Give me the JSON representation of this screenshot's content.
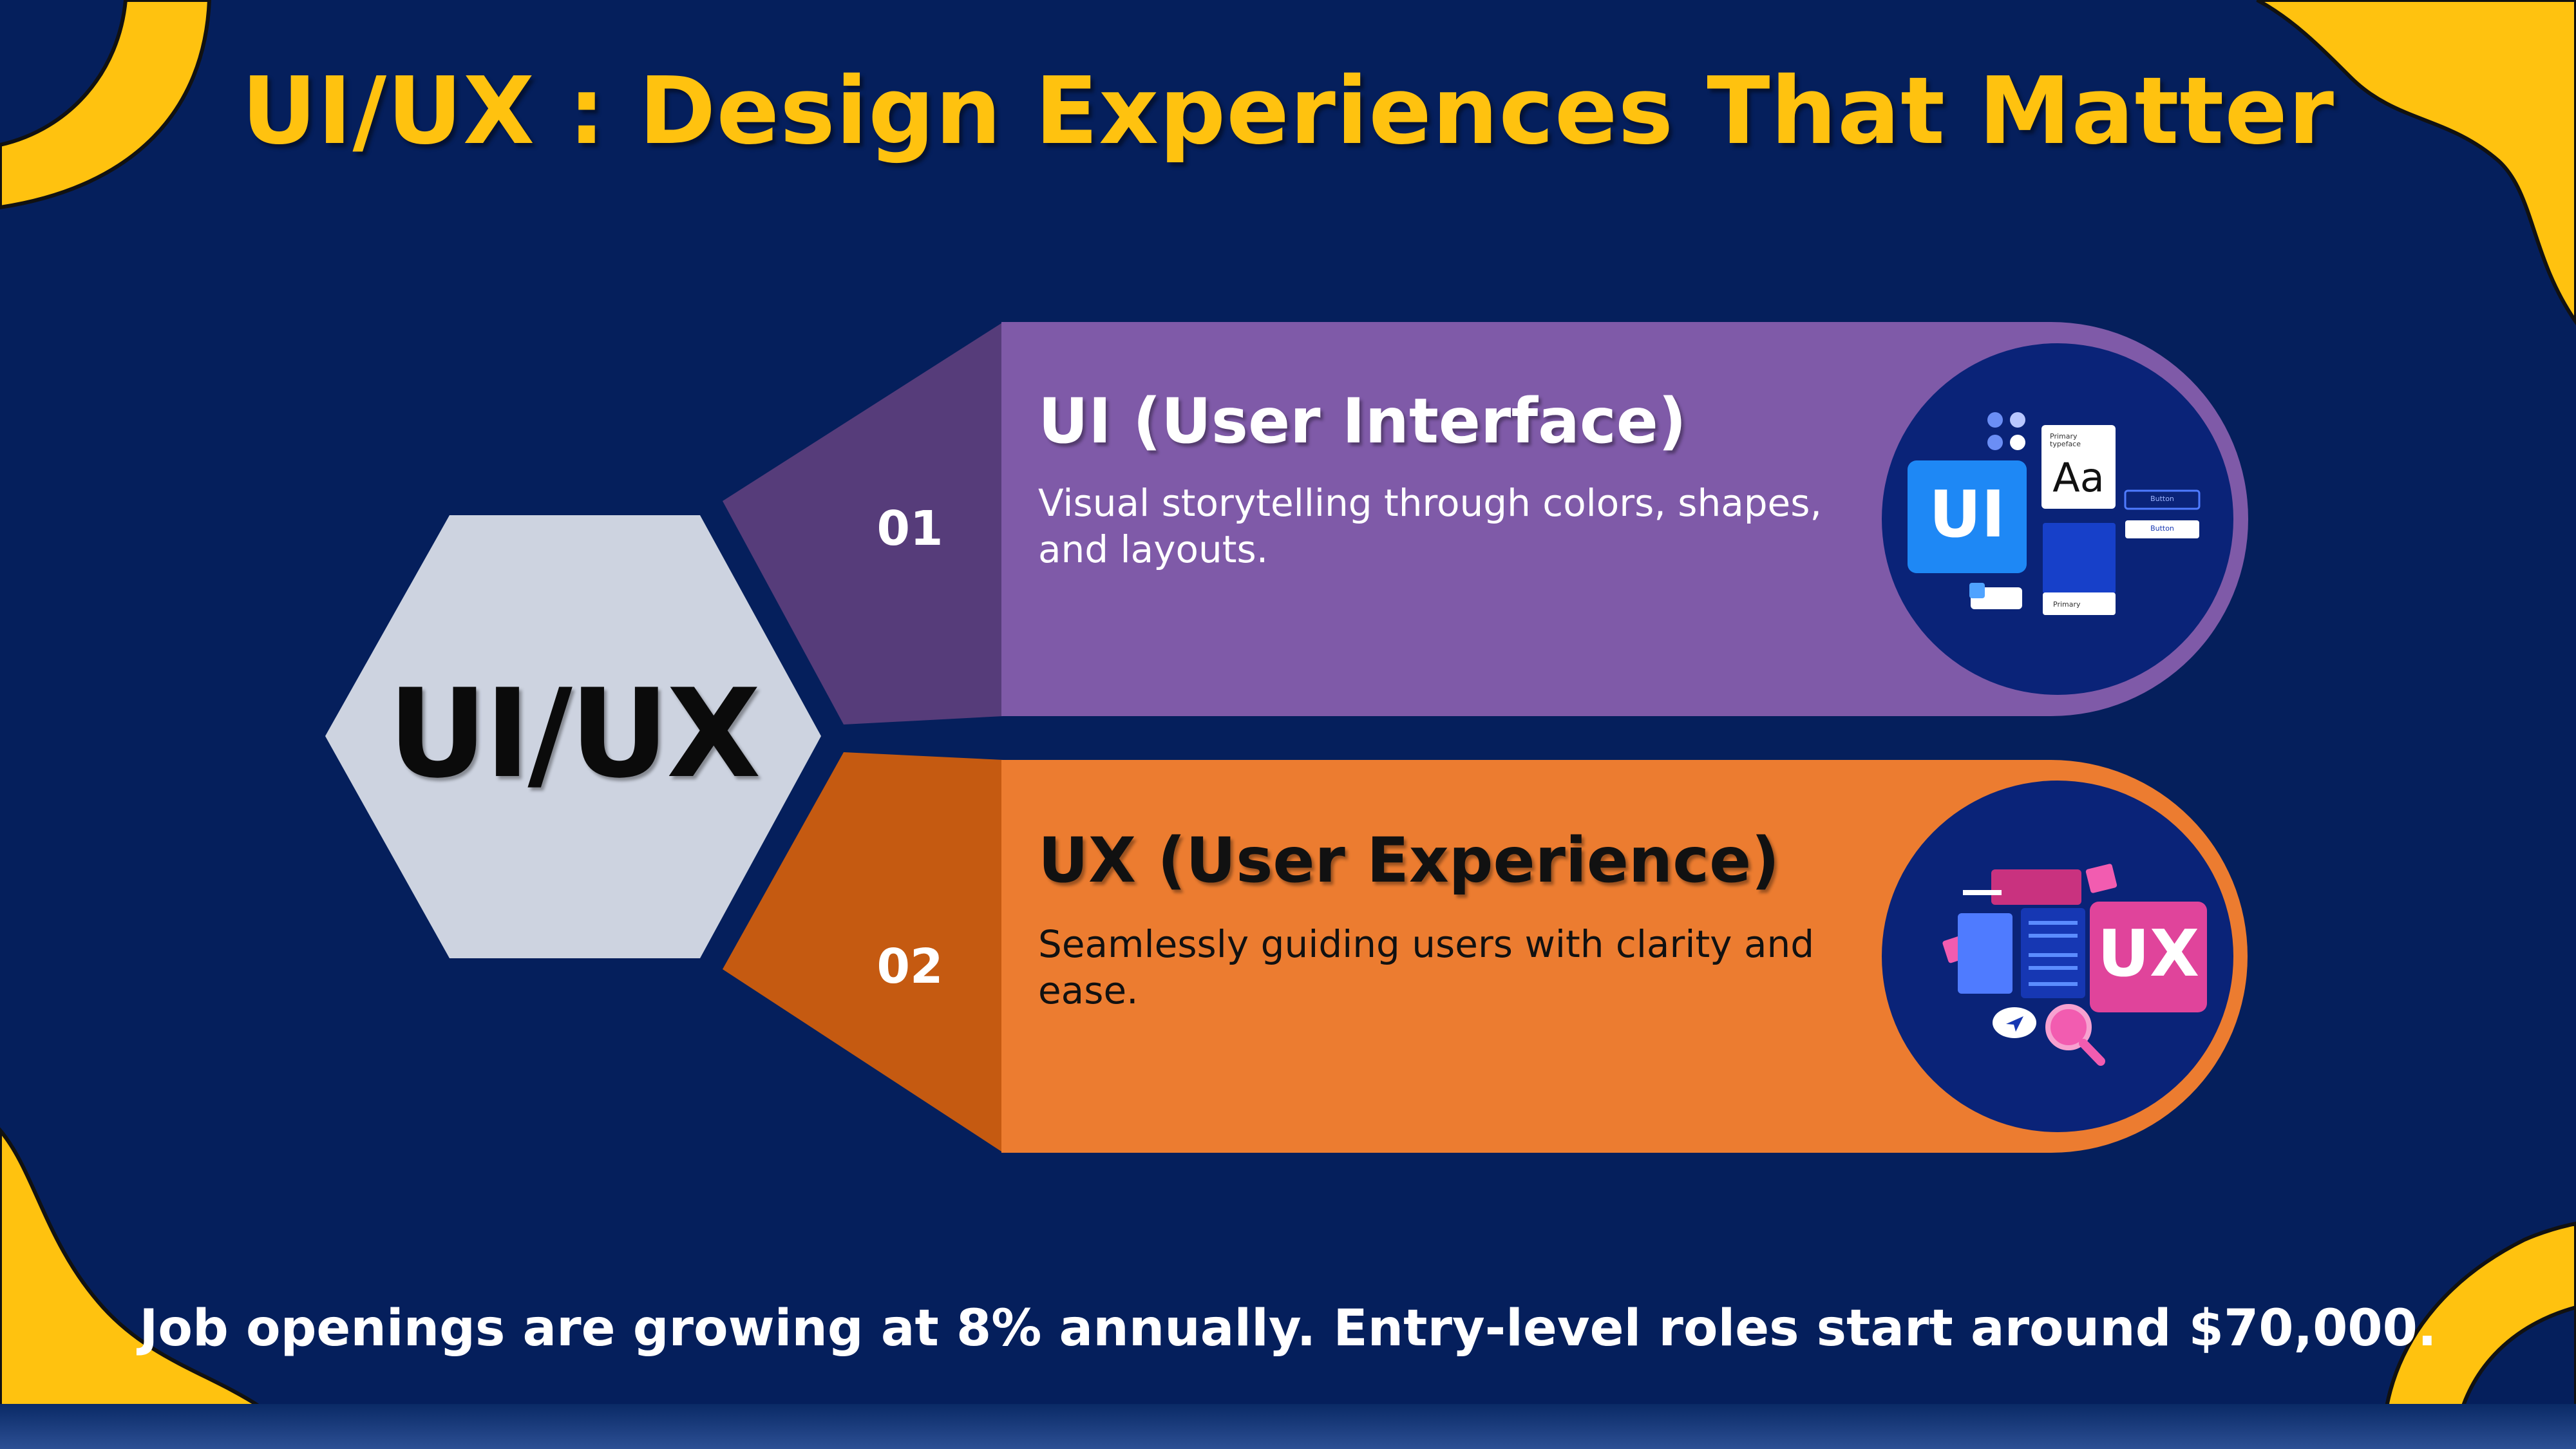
{
  "slide": {
    "title": "UI/UX : Design Experiences That Matter",
    "center_label": "UI/UX",
    "footer": "Job openings are growing at 8% annually. Entry-level roles start around $70,000."
  },
  "cards": [
    {
      "number": "01",
      "title": "UI (User Interface)",
      "description": "Visual storytelling through colors, shapes, and layouts.",
      "illustration": {
        "badge": "UI",
        "type_sample": "Aa",
        "type_caption": "Primary typeface",
        "button_1": "Button",
        "button_2": "Button",
        "swatch_caption": "Primary"
      }
    },
    {
      "number": "02",
      "title": "UX (User Experience)",
      "description": "Seamlessly guiding users with clarity and ease.",
      "illustration": {
        "badge": "UX"
      }
    }
  ],
  "colors": {
    "background": "#051f5c",
    "accent_yellow": "#ffc20f",
    "hexagon": "#cdd3e0",
    "ui_card": "#7f5aa8",
    "ui_card_dark": "#563c7a",
    "ux_card": "#ec7c30",
    "ux_card_dark": "#c55a11",
    "circle_fill": "#0a2378",
    "ui_badge": "#1e88f5",
    "ux_badge": "#e0449b"
  }
}
